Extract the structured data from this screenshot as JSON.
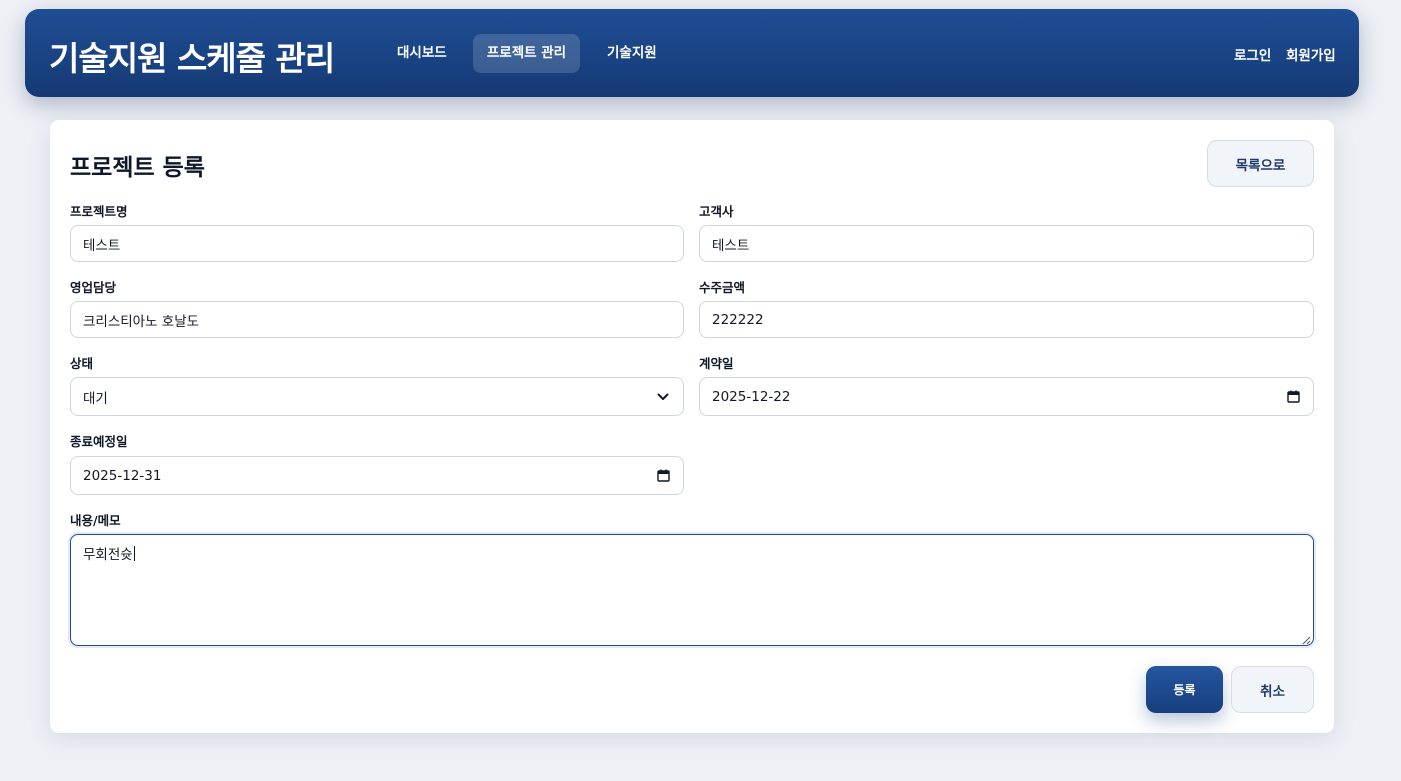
{
  "header": {
    "brand": "기술지원 스케줄 관리",
    "nav": [
      {
        "label": "대시보드"
      },
      {
        "label": "프로젝트 관리"
      },
      {
        "label": "기술지원"
      }
    ],
    "auth": {
      "login": "로그인",
      "signup": "회원가입"
    }
  },
  "page": {
    "title": "프로젝트 등록",
    "back_label": "목록으로"
  },
  "form": {
    "project_name": {
      "label": "프로젝트명",
      "value": "테스트"
    },
    "client": {
      "label": "고객사",
      "value": "테스트"
    },
    "sales_rep": {
      "label": "영업담당",
      "value": "크리스티아노 호날도"
    },
    "order_amount": {
      "label": "수주금액",
      "value": "222222"
    },
    "status": {
      "label": "상태",
      "value": "대기"
    },
    "contract_date": {
      "label": "계약일",
      "value": "2025-12-22"
    },
    "end_date": {
      "label": "종료예정일",
      "value": "2025-12-31"
    },
    "memo": {
      "label": "내용/메모",
      "value": "무회전슛"
    }
  },
  "actions": {
    "submit": "등록",
    "cancel": "취소"
  },
  "icons": {
    "select": "chevron-down-icon",
    "date": "calendar-icon",
    "resize": "resize-handle-icon"
  },
  "colors": {
    "primary": "#1f4e95",
    "background": "#edf0f5",
    "card": "#ffffff"
  }
}
